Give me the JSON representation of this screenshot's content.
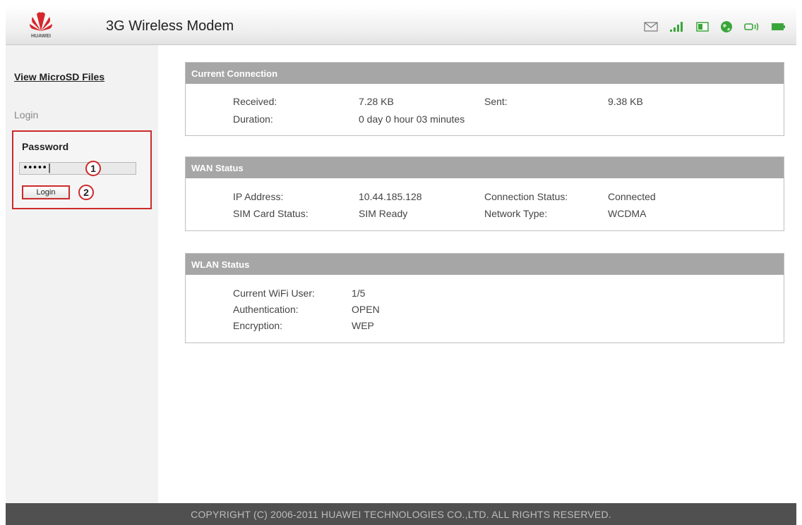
{
  "header": {
    "brand": "HUAWEI",
    "title": "3G Wireless Modem",
    "status_icons": [
      "mail-icon",
      "signal-strength-icon",
      "sim-card-icon",
      "globe-icon",
      "wifi-icon",
      "battery-icon"
    ],
    "accent_color": "#33aa33"
  },
  "sidebar": {
    "link": "View MicroSD Files",
    "login_heading": "Login",
    "login_form": {
      "password_label": "Password",
      "password_value": "•••••|",
      "login_button": "Login",
      "markers": [
        "1",
        "2"
      ],
      "highlight_color": "#cc2a2a"
    }
  },
  "current_connection": {
    "title": "Current Connection",
    "received_label": "Received:",
    "received_value": "7.28 KB",
    "sent_label": "Sent:",
    "sent_value": "9.38 KB",
    "duration_label": "Duration:",
    "duration_value": "0 day 0 hour 03 minutes"
  },
  "wan_status": {
    "title": "WAN Status",
    "ip_label": "IP Address:",
    "ip_value": "10.44.185.128",
    "conn_label": "Connection Status:",
    "conn_value": "Connected",
    "sim_label": "SIM Card Status:",
    "sim_value": "SIM Ready",
    "net_label": "Network Type:",
    "net_value": "WCDMA"
  },
  "wlan_status": {
    "title": "WLAN Status",
    "user_label": "Current WiFi User:",
    "user_value": "1/5",
    "auth_label": "Authentication:",
    "auth_value": "OPEN",
    "enc_label": "Encryption:",
    "enc_value": "WEP"
  },
  "footer": {
    "copyright": "COPYRIGHT (C) 2006-2011 HUAWEI TECHNOLOGIES CO.,LTD. ALL RIGHTS RESERVED."
  }
}
